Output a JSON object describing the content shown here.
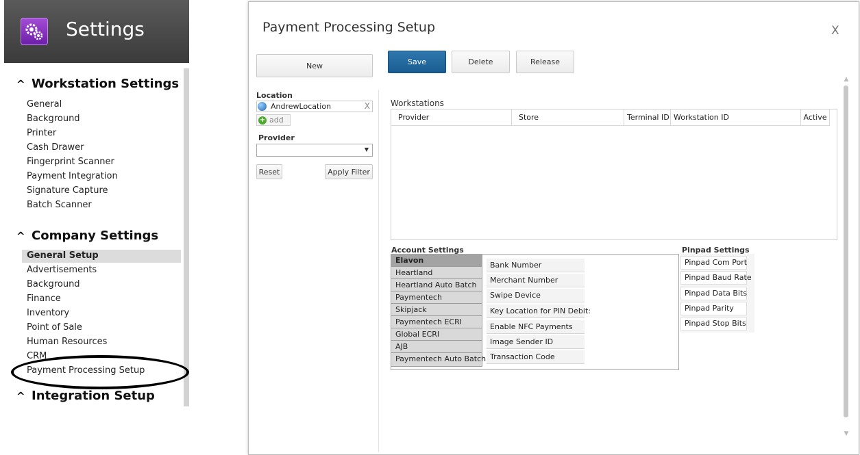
{
  "sidebar": {
    "title": "Settings",
    "sections": [
      {
        "title": "Workstation Settings",
        "items": [
          "General",
          "Background",
          "Printer",
          "Cash Drawer",
          "Fingerprint Scanner",
          "Payment Integration",
          "Signature Capture",
          "Batch Scanner"
        ]
      },
      {
        "title": "Company Settings",
        "items": [
          "General Setup",
          "Advertisements",
          "Background",
          "Finance",
          "Inventory",
          "Point of Sale",
          "Human Resources",
          "CRM",
          "Payment Processing Setup"
        ]
      },
      {
        "title": "Integration Setup",
        "items": []
      }
    ]
  },
  "dialog": {
    "title": "Payment Processing Setup",
    "close_label": "X",
    "new_label": "New",
    "save_label": "Save",
    "delete_label": "Delete",
    "release_label": "Release",
    "location_label": "Location",
    "location_value": "AndrewLocation",
    "location_clear": "X",
    "add_label": "add",
    "provider_label": "Provider",
    "provider_value": "",
    "reset_label": "Reset",
    "apply_filter_label": "Apply Filter",
    "workstations_label": "Workstations",
    "workstation_columns": [
      "Provider",
      "Store",
      "Terminal ID",
      "Workstation ID",
      "Active"
    ],
    "account_settings_label": "Account Settings",
    "providers": [
      "Elavon",
      "Heartland",
      "Heartland Auto Batch",
      "Paymentech",
      "Skipjack",
      "Paymentech ECRI",
      "Global ECRI",
      "AJB",
      "Paymentech Auto Batch"
    ],
    "selected_provider": "Elavon",
    "account_fields": [
      "Bank Number",
      "Merchant Number",
      "Swipe Device",
      "Key Location for PIN Debit:",
      "Enable NFC Payments",
      "Image Sender ID",
      "Transaction Code"
    ],
    "pinpad_settings_label": "Pinpad Settings",
    "pinpad_fields": [
      "Pinpad Com Port",
      "Pinpad Baud Rate",
      "Pinpad Data Bits",
      "Pinpad Parity",
      "Pinpad Stop Bits"
    ]
  },
  "colors": {
    "primary_button": "#1f65a0",
    "header_bg": "#4a4a4a",
    "logo_purple": "#8a34c2",
    "selected_provider_bg": "#a3a3a3"
  }
}
